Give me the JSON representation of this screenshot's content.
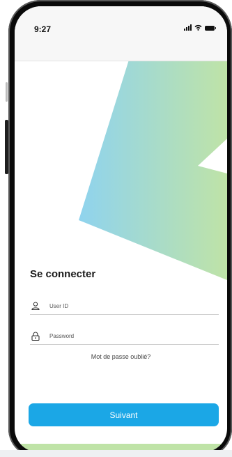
{
  "status_bar": {
    "time": "9:27",
    "signal_icon": "cellular-signal-icon",
    "wifi_icon": "wifi-icon",
    "battery_icon": "battery-icon"
  },
  "login": {
    "title": "Se connecter",
    "user_field": {
      "placeholder": "User ID",
      "value": "",
      "icon": "user-icon"
    },
    "password_field": {
      "placeholder": "Password",
      "value": "",
      "icon": "lock-icon"
    },
    "forgot_password_link": "Mot de passe oublié?",
    "submit_button": "Suivant"
  },
  "colors": {
    "accent": "#1ba7e6",
    "gradient_start": "#8fd3ee",
    "gradient_end": "#bfe3a7"
  }
}
